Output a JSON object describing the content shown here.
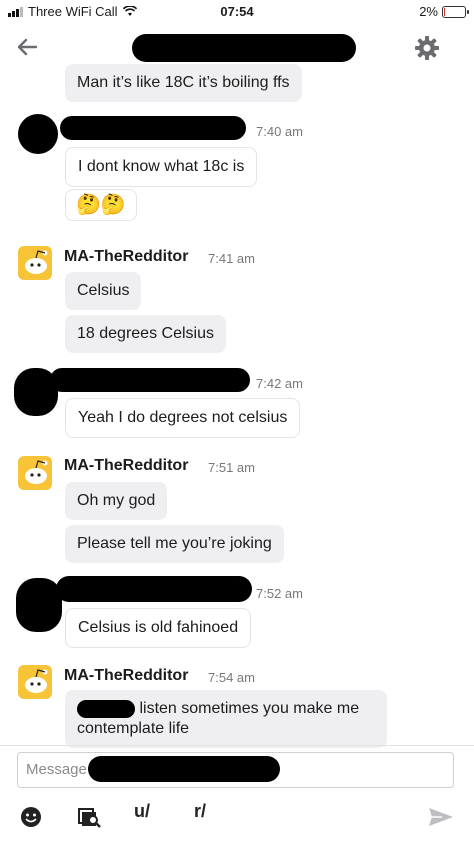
{
  "status_bar": {
    "carrier": "Three WiFi Call",
    "time": "07:54",
    "battery": "2%",
    "battery_level": 0.02
  },
  "header": {
    "back_icon": "arrow-left-icon",
    "settings_icon": "gear-icon"
  },
  "messages": {
    "m1": "Man it’s like 18C it’s boiling ffs",
    "g2_time": "7:40 am",
    "m2": "I dont know what 18c is",
    "m2_emoji": "🤔🤔",
    "g3_name": "MA-TheRedditor",
    "g3_time": "7:41 am",
    "m3a": "Celsius",
    "m3b": "18 degrees Celsius",
    "g4_time": "7:42 am",
    "m4": "Yeah I do degrees not celsius",
    "g5_name": "MA-TheRedditor",
    "g5_time": "7:51 am",
    "m5a": "Oh my god",
    "m5b": "Please tell me you’re joking",
    "g6_time": "7:52 am",
    "m6": "Celsius is old fahinoed",
    "g7_name": "MA-TheRedditor",
    "g7_time": "7:54 am",
    "m7_line1": "listen sometimes you make me",
    "m7_line2": "contemplate life"
  },
  "composer": {
    "placeholder": "Message",
    "tools": {
      "emoji_icon": "smiley-icon",
      "media_icon": "media-search-icon",
      "user_label": "u/",
      "sub_label": "r/",
      "send_icon": "send-icon"
    }
  },
  "colors": {
    "bubble_gray": "#efeff2",
    "avatar_yellow": "#f7c437",
    "accent": "#1c1c1c"
  }
}
